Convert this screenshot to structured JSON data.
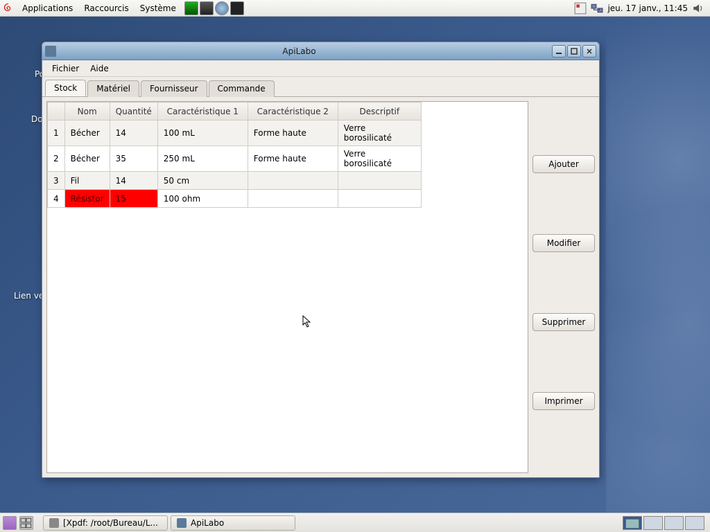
{
  "panel": {
    "menus": {
      "applications": "Applications",
      "shortcuts": "Raccourcis",
      "system": "Système"
    },
    "clock": "jeu.  17 janv.,  11:45"
  },
  "desktop_icons": {
    "computer": "Pos",
    "home": "Doss",
    "link": "Lien ve"
  },
  "window": {
    "title": "ApiLabo",
    "menus": {
      "file": "Fichier",
      "help": "Aide"
    },
    "tabs": {
      "stock": "Stock",
      "material": "Matériel",
      "supplier": "Fournisseur",
      "order": "Commande"
    },
    "table": {
      "headers": {
        "name": "Nom",
        "qty": "Quantité",
        "c1": "Caractéristique 1",
        "c2": "Caractéristique 2",
        "desc": "Descriptif"
      },
      "rows": [
        {
          "n": "1",
          "name": "Bécher",
          "qty": "14",
          "c1": "100 mL",
          "c2": "Forme haute",
          "desc": "Verre borosilicaté",
          "highlight": false
        },
        {
          "n": "2",
          "name": "Bécher",
          "qty": "35",
          "c1": "250 mL",
          "c2": "Forme haute",
          "desc": "Verre borosilicaté",
          "highlight": false
        },
        {
          "n": "3",
          "name": "Fil",
          "qty": "14",
          "c1": "50 cm",
          "c2": "",
          "desc": "",
          "highlight": false
        },
        {
          "n": "4",
          "name": "Résistor",
          "qty": "15",
          "c1": "100 ohm",
          "c2": "",
          "desc": "",
          "highlight": true
        }
      ]
    },
    "buttons": {
      "add": "Ajouter",
      "modify": "Modifier",
      "delete": "Supprimer",
      "print": "Imprimer"
    }
  },
  "taskbar": {
    "tasks": [
      {
        "label": "[Xpdf: /root/Bureau/L..."
      },
      {
        "label": "ApiLabo"
      }
    ]
  }
}
